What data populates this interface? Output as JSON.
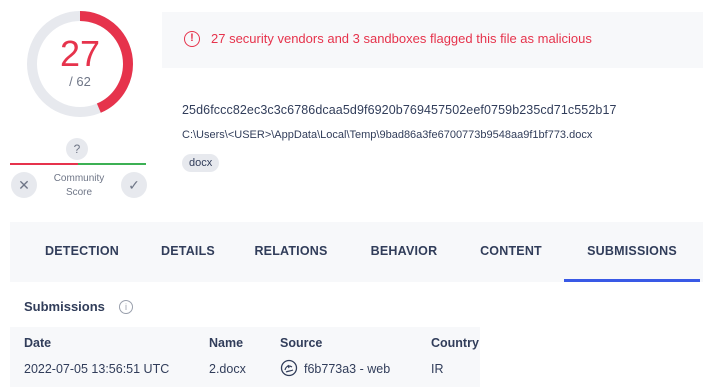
{
  "score": {
    "detections": "27",
    "total": "/ 62",
    "detection_ratio": 0.435,
    "ring_color": "#e6334c"
  },
  "community": {
    "question_mark": "?",
    "label_line1": "Community",
    "label_line2": "Score",
    "vote_down_icon": "close-icon",
    "vote_up_icon": "check-icon"
  },
  "alert": {
    "icon": "alert-circle-icon",
    "icon_glyph": "!",
    "text": "27 security vendors and 3 sandboxes flagged this file as malicious",
    "color": "#e6334c"
  },
  "file": {
    "hash": "25d6fccc82ec3c3c6786dcaa5d9f6920b769457502eef0759b235cd71c552b17",
    "path": "C:\\Users\\<USER>\\AppData\\Local\\Temp\\9bad86a3fe6700773b9548aa9f1bf773.docx",
    "tag": "docx"
  },
  "tabs": [
    {
      "label": "DETECTION",
      "active": false
    },
    {
      "label": "DETAILS",
      "active": false
    },
    {
      "label": "RELATIONS",
      "active": false
    },
    {
      "label": "BEHAVIOR",
      "active": false
    },
    {
      "label": "CONTENT",
      "active": false
    },
    {
      "label": "SUBMISSIONS",
      "active": true
    }
  ],
  "accent_color": "#3959e6",
  "submissions": {
    "title": "Submissions",
    "info_icon": "info-icon",
    "columns": [
      "Date",
      "Name",
      "Source",
      "Country"
    ],
    "rows": [
      {
        "date": "2022-07-05 13:56:51 UTC",
        "name": "2.docx",
        "source": "f6b773a3 - web",
        "source_icon": "user-avatar-icon",
        "country": "IR"
      }
    ]
  }
}
